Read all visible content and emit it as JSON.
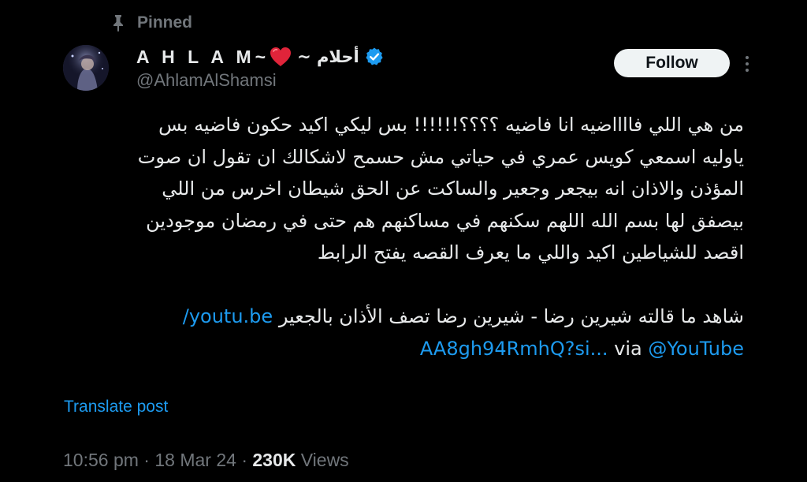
{
  "pinned": {
    "label": "Pinned",
    "icon": "pin-icon"
  },
  "author": {
    "name_latin": "A H L A M",
    "tilde_left": "~",
    "heart": "❤️",
    "name_arabic": "~ أحلام",
    "handle": "@AhlamAlShamsi",
    "verified_icon": "verified-badge-icon",
    "verified_color": "#1d9bf0"
  },
  "actions": {
    "follow_label": "Follow",
    "more_icon": "more-options-icon"
  },
  "tweet": {
    "lines": [
      "من هي اللي فااااضيه انا فاضيه ؟؟؟؟!!!!!! بس ليكي اكيد حكون فاضيه بس",
      "ياوليه اسمعي كويس عمري في حياتي مش حسمح لاشكالك ان تقول ان صوت",
      "المؤذن والاذان انه بيجعر وجعير والساكت عن الحق شيطان اخرس من اللي",
      "بيصفق لها بسم الله اللهم سكنهم في مساكنهم هم حتى في رمضان موجودين",
      "اقصد للشياطين اكيد واللي ما يعرف القصه يفتح الرابط"
    ],
    "link_caption": "شاهد ما قالته شيرين رضا - شيرين رضا تصف الأذان بالجعير",
    "link_part1": "youtu.be/",
    "link_part2": "AA8gh94RmhQ?si...",
    "via_text": "via",
    "mention": "@YouTube"
  },
  "translate_label": "Translate post",
  "meta": {
    "time": "10:56 pm",
    "separator": "·",
    "date": "18 Mar 24",
    "views_count": "230K",
    "views_label": "Views"
  },
  "colors": {
    "background": "#000000",
    "text": "#e7e9ea",
    "secondary": "#71767b",
    "accent": "#1d9bf0",
    "follow_bg": "#eff3f4"
  }
}
